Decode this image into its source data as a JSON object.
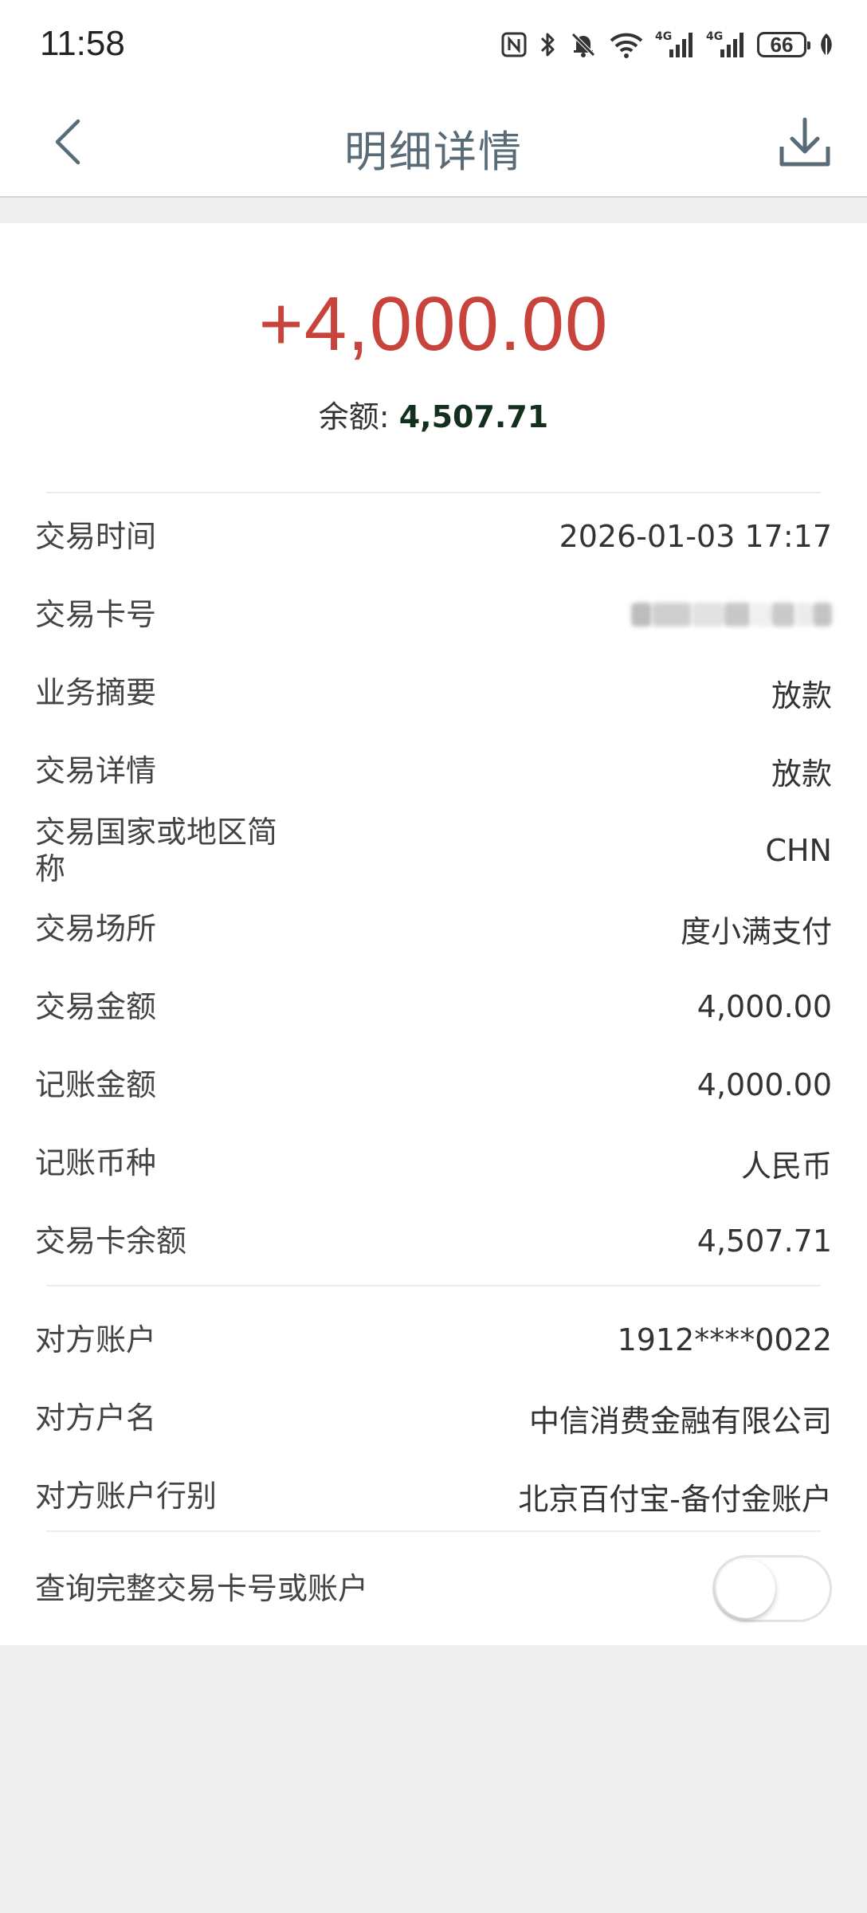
{
  "status_bar": {
    "time": "11:58",
    "battery": "66",
    "icons": [
      "nfc-icon",
      "bluetooth-icon",
      "mute-icon",
      "wifi-icon",
      "signal-4g-icon",
      "signal-4g-icon",
      "battery-icon",
      "leaf-icon"
    ]
  },
  "nav": {
    "title": "明细详情"
  },
  "summary": {
    "amount": "+4,000.00",
    "balance_label": "余额: ",
    "balance_value": "4,507.71",
    "amount_color": "#c8433c"
  },
  "details": [
    {
      "label": "交易时间",
      "value": "2026-01-03 17:17"
    },
    {
      "label": "交易卡号",
      "value": ""
    },
    {
      "label": "业务摘要",
      "value": "放款"
    },
    {
      "label": "交易详情",
      "value": "放款"
    },
    {
      "label": "交易国家或地区简称",
      "value": "CHN"
    },
    {
      "label": "交易场所",
      "value": "度小满支付"
    },
    {
      "label": "交易金额",
      "value": "4,000.00"
    },
    {
      "label": "记账金额",
      "value": "4,000.00"
    },
    {
      "label": "记账币种",
      "value": "人民币"
    },
    {
      "label": "交易卡余额",
      "value": "4,507.71"
    }
  ],
  "counterparty": [
    {
      "label": "对方账户",
      "value": "1912****0022"
    },
    {
      "label": "对方户名",
      "value": "中信消费金融有限公司"
    },
    {
      "label": "对方账户行别",
      "value": "北京百付宝-备付金账户"
    }
  ],
  "query_toggle": {
    "label": "查询完整交易卡号或账户",
    "enabled": false
  }
}
